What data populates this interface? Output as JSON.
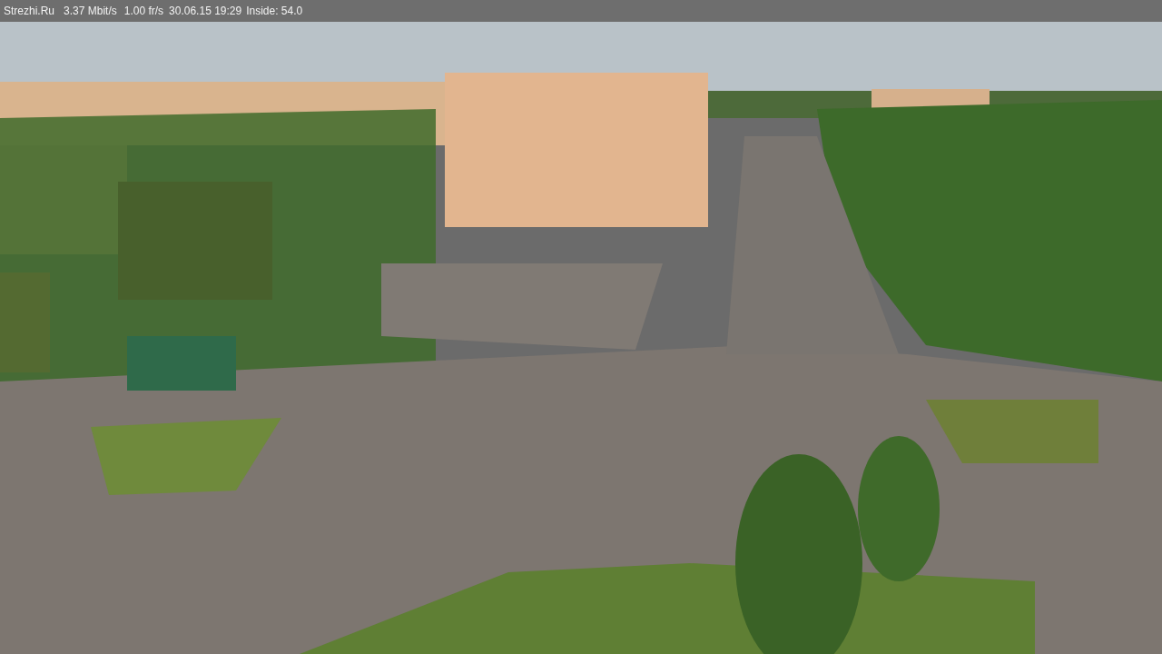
{
  "overlay": {
    "site": "Strezhi.Ru",
    "bitrate": "3.37 Mbit/s",
    "frame_rate": "1.00 fr/s",
    "timestamp": "30.06.15 19:29",
    "sensor": "Inside: 54.0"
  }
}
